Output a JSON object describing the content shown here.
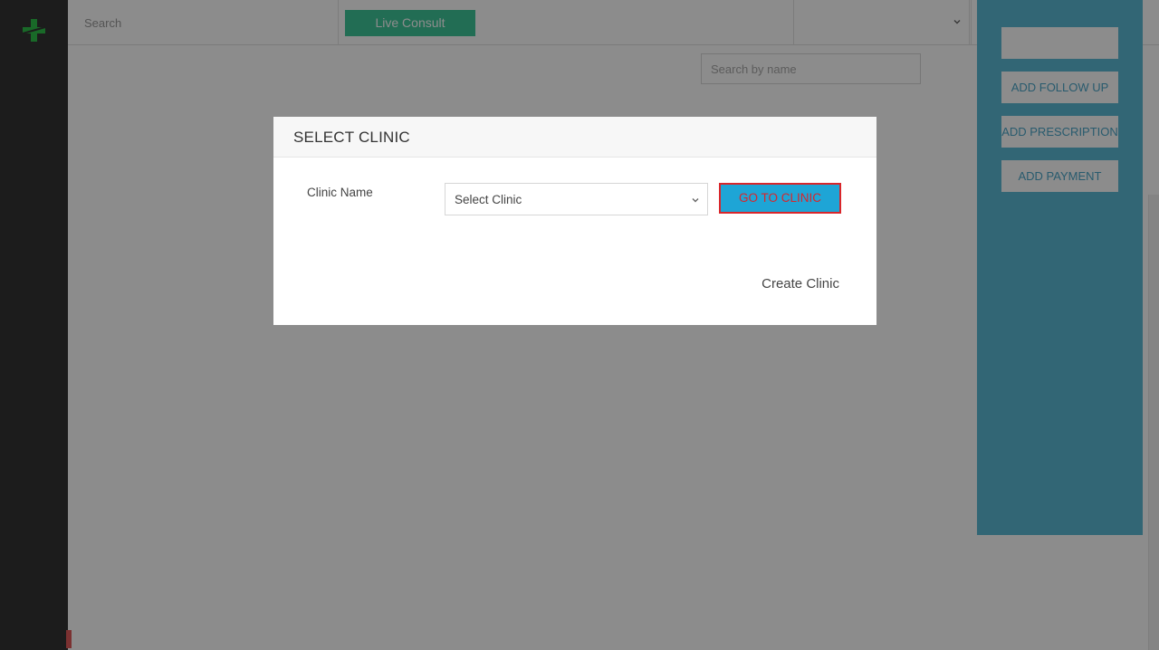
{
  "topbar": {
    "search_placeholder": "Search",
    "live_consult_label": "Live Consult",
    "selected_value": ""
  },
  "content": {
    "search_by_name_placeholder": "Search by name"
  },
  "right_panel": {
    "buttons": [
      {
        "label": ""
      },
      {
        "label": "ADD FOLLOW UP"
      },
      {
        "label": "ADD PRESCRIPTION"
      },
      {
        "label": "ADD PAYMENT"
      }
    ]
  },
  "modal": {
    "title": "SELECT CLINIC",
    "clinic_name_label": "Clinic Name",
    "clinic_select_value": "Select Clinic",
    "go_button_label": "GO TO CLINIC",
    "create_link_label": "Create Clinic"
  },
  "icons": {
    "logo": "medical-cross-icon",
    "add": "plus-icon",
    "notifications": "bell-icon",
    "profile": "user-icon",
    "dropdown": "chevron-down-icon"
  },
  "colors": {
    "sidebar": "#333333",
    "panel": "#5bbad5",
    "live_consult": "#3fc79a",
    "go_button_bg": "#1ea5d6",
    "go_button_text": "#d9262b",
    "logo_green": "#2fbf4a"
  }
}
